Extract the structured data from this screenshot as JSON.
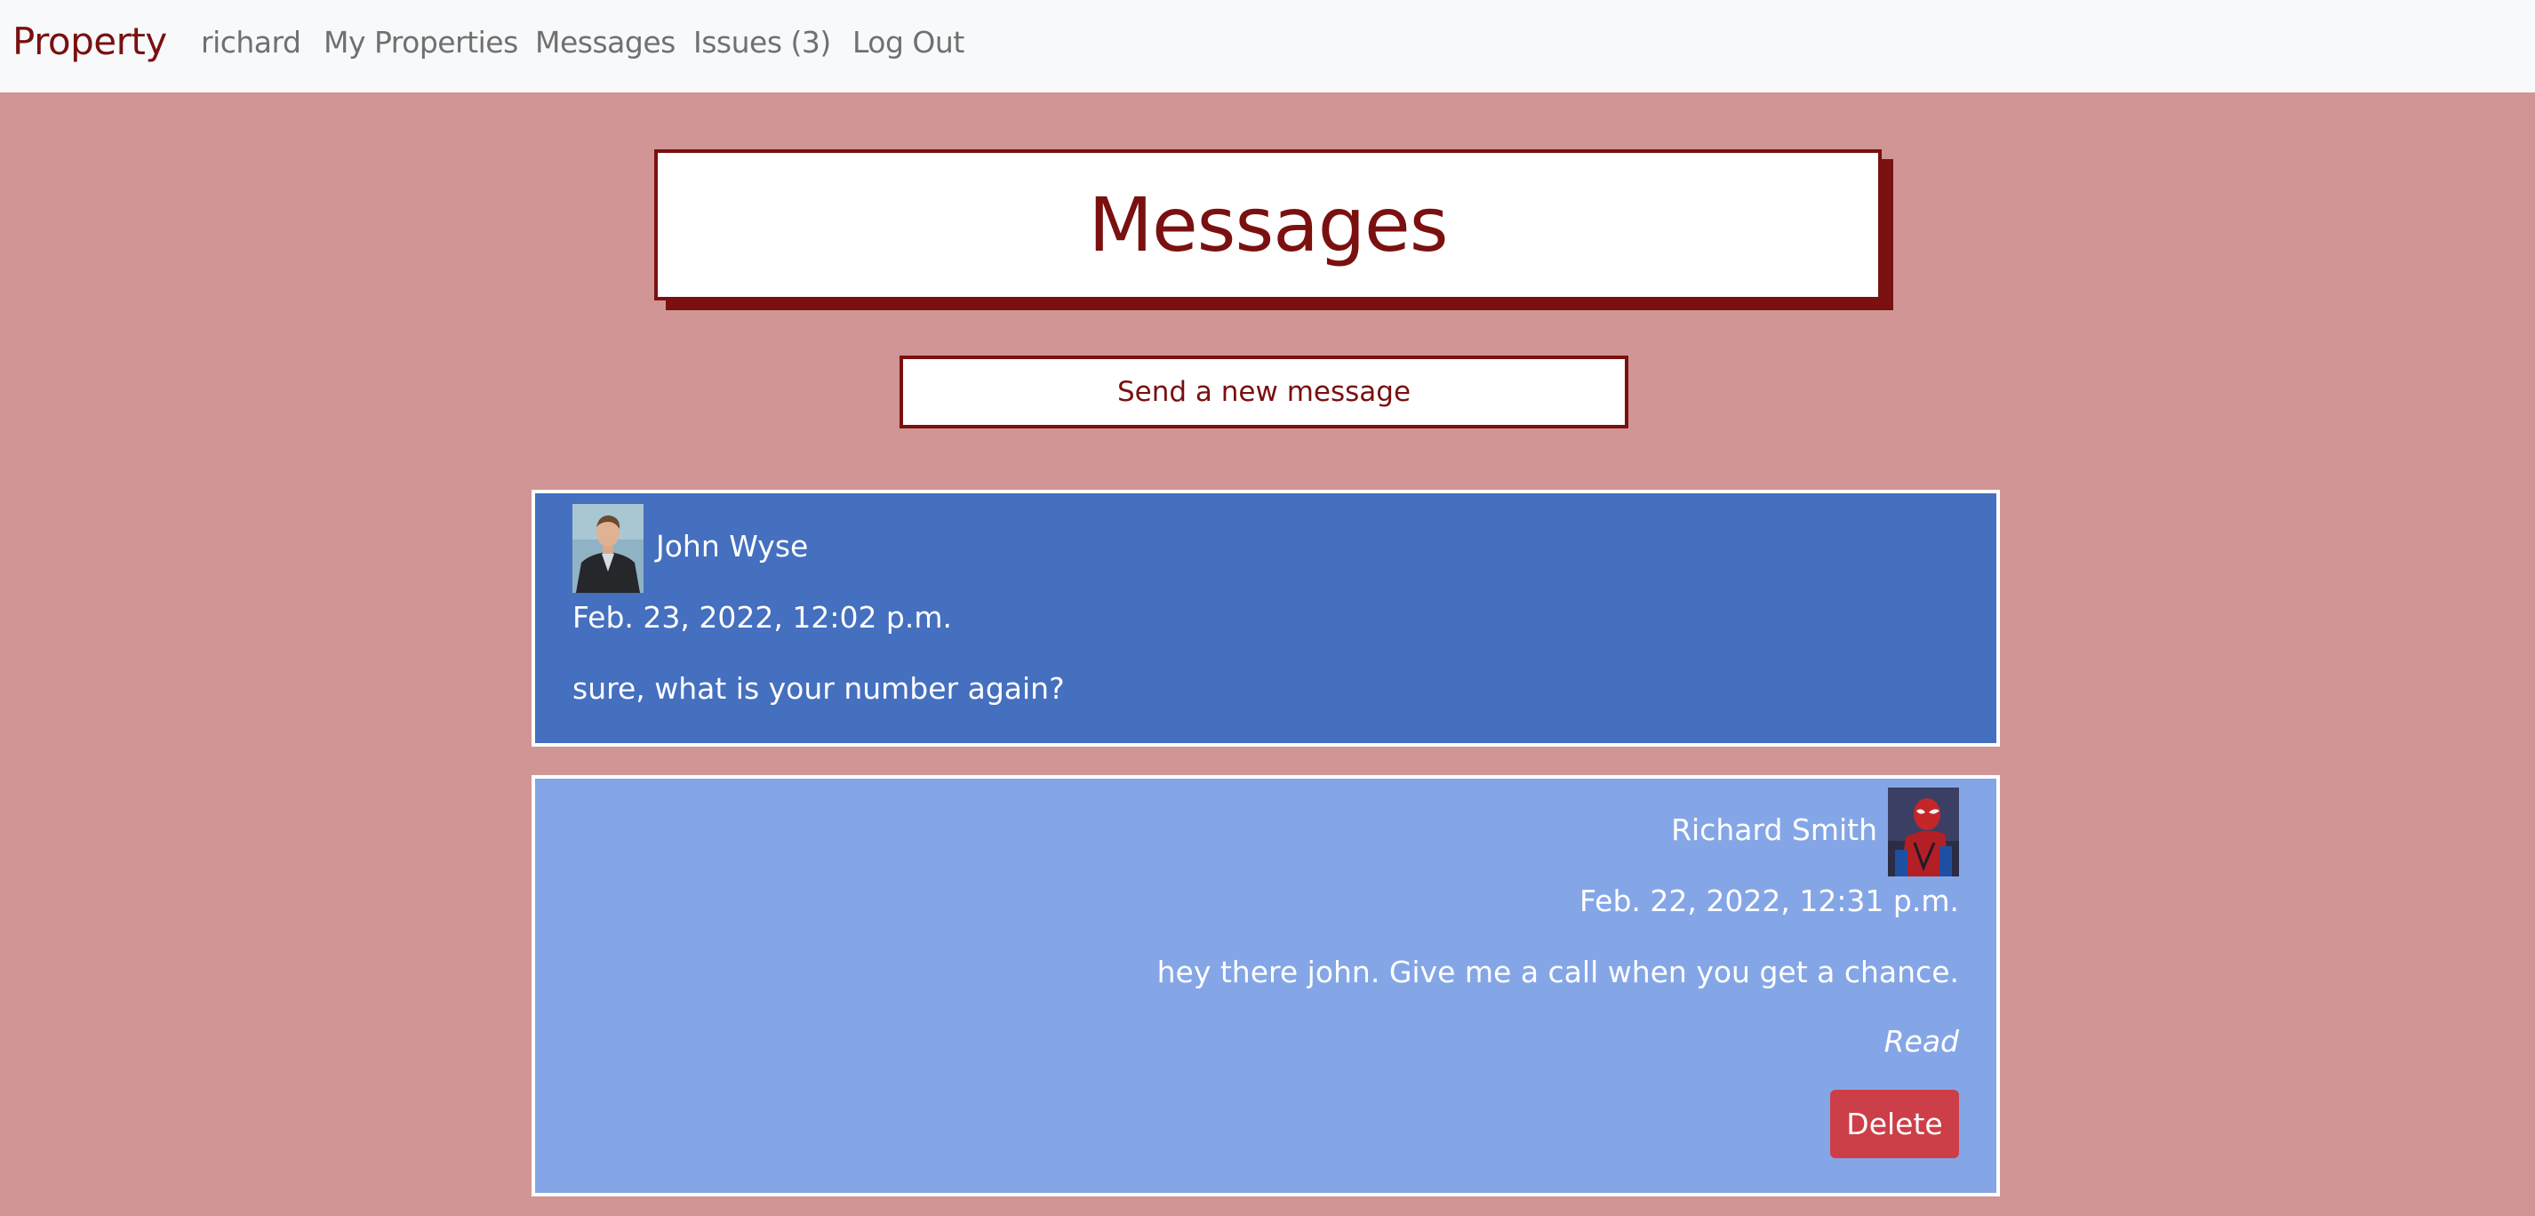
{
  "navbar": {
    "brand": "Property",
    "links": {
      "user": "richard",
      "properties": "My Properties",
      "messages": "Messages",
      "issues": "Issues (3)",
      "logout": "Log Out"
    }
  },
  "page": {
    "title": "Messages",
    "new_message_label": "Send a new message"
  },
  "messages": [
    {
      "sender": "John Wyse",
      "timestamp": "Feb. 23, 2022, 12:02 p.m.",
      "body": "sure, what is your number again?"
    },
    {
      "sender": "Richard Smith",
      "timestamp": "Feb. 22, 2022, 12:31 p.m.",
      "body": "hey there john. Give me a call when you get a chance.",
      "status": "Read",
      "delete_label": "Delete"
    }
  ],
  "colors": {
    "page_background": "#d29595",
    "brand": "#7a1010",
    "received_card": "#456fbf",
    "sent_card": "#85a6e6",
    "delete_button": "#cc3e48"
  }
}
